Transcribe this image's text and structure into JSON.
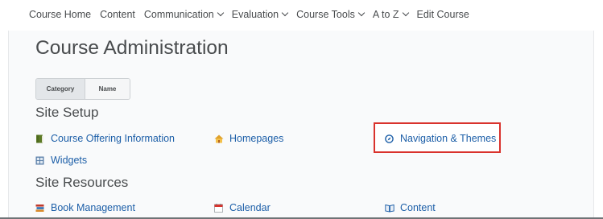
{
  "nav": {
    "items": [
      {
        "label": "Course Home",
        "has_menu": false
      },
      {
        "label": "Content",
        "has_menu": false
      },
      {
        "label": "Communication",
        "has_menu": true
      },
      {
        "label": "Evaluation",
        "has_menu": true
      },
      {
        "label": "Course Tools",
        "has_menu": true
      },
      {
        "label": "A to Z",
        "has_menu": true
      },
      {
        "label": "Edit Course",
        "has_menu": false
      }
    ]
  },
  "page": {
    "title": "Course Administration"
  },
  "view_toggle": {
    "category_label": "Category",
    "name_label": "Name",
    "selected": "Category"
  },
  "sections": {
    "site_setup": {
      "heading": "Site Setup",
      "tools": {
        "course_offering": {
          "label": "Course Offering Information",
          "icon": "book-icon"
        },
        "homepages": {
          "label": "Homepages",
          "icon": "house-icon"
        },
        "navigation_themes": {
          "label": "Navigation & Themes",
          "icon": "compass-icon"
        },
        "widgets": {
          "label": "Widgets",
          "icon": "widget-grid-icon"
        }
      }
    },
    "site_resources": {
      "heading": "Site Resources",
      "tools": {
        "book_management": {
          "label": "Book Management",
          "icon": "books-icon"
        },
        "calendar": {
          "label": "Calendar",
          "icon": "calendar-icon"
        },
        "content": {
          "label": "Content",
          "icon": "open-book-icon"
        }
      }
    }
  },
  "colors": {
    "link": "#1d5fa8",
    "highlight": "#d9322c",
    "text": "#494c4e"
  }
}
